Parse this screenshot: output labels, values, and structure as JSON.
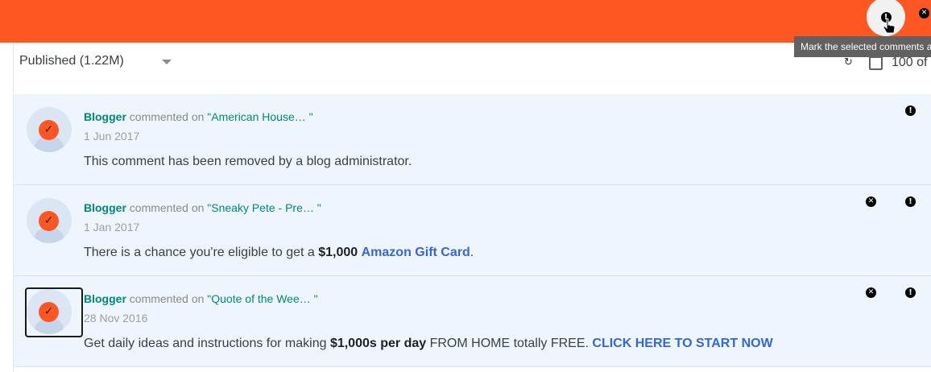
{
  "header": {
    "tooltip": "Mark the selected comments as spam",
    "spam_icon": "spam-icon",
    "delete_icon": "delete-icon",
    "colors": {
      "accent": "#ff5722",
      "row_bg": "#eef5fc",
      "link": "#3367d6",
      "author": "#00897b"
    }
  },
  "toolbar": {
    "filter_label": "Published (1.22M)",
    "count_label": "100 of",
    "refresh_icon": "refresh-icon"
  },
  "comments": [
    {
      "author": "Blogger",
      "verb": "commented on",
      "post": "\"American House… \"",
      "date": "1 Jun 2017",
      "text_parts": [
        "This comment has been removed by a blog administrator.",
        "",
        "",
        "",
        ""
      ]
    },
    {
      "author": "Blogger",
      "verb": "commented on",
      "post": "\"Sneaky Pete - Pre… \"",
      "date": "1 Jan 2017",
      "text_parts": [
        "There is a chance you're eligible to get a ",
        "$1,000",
        " ",
        "Amazon Gift Card",
        "."
      ]
    },
    {
      "author": "Blogger",
      "verb": "commented on",
      "post": "\"Quote of the Wee… \"",
      "date": "28 Nov 2016",
      "text_parts": [
        "Get daily ideas and instructions for making ",
        "$1,000s per day",
        " FROM HOME totally FREE. ",
        "CLICK HERE TO START NOW",
        ""
      ]
    }
  ]
}
